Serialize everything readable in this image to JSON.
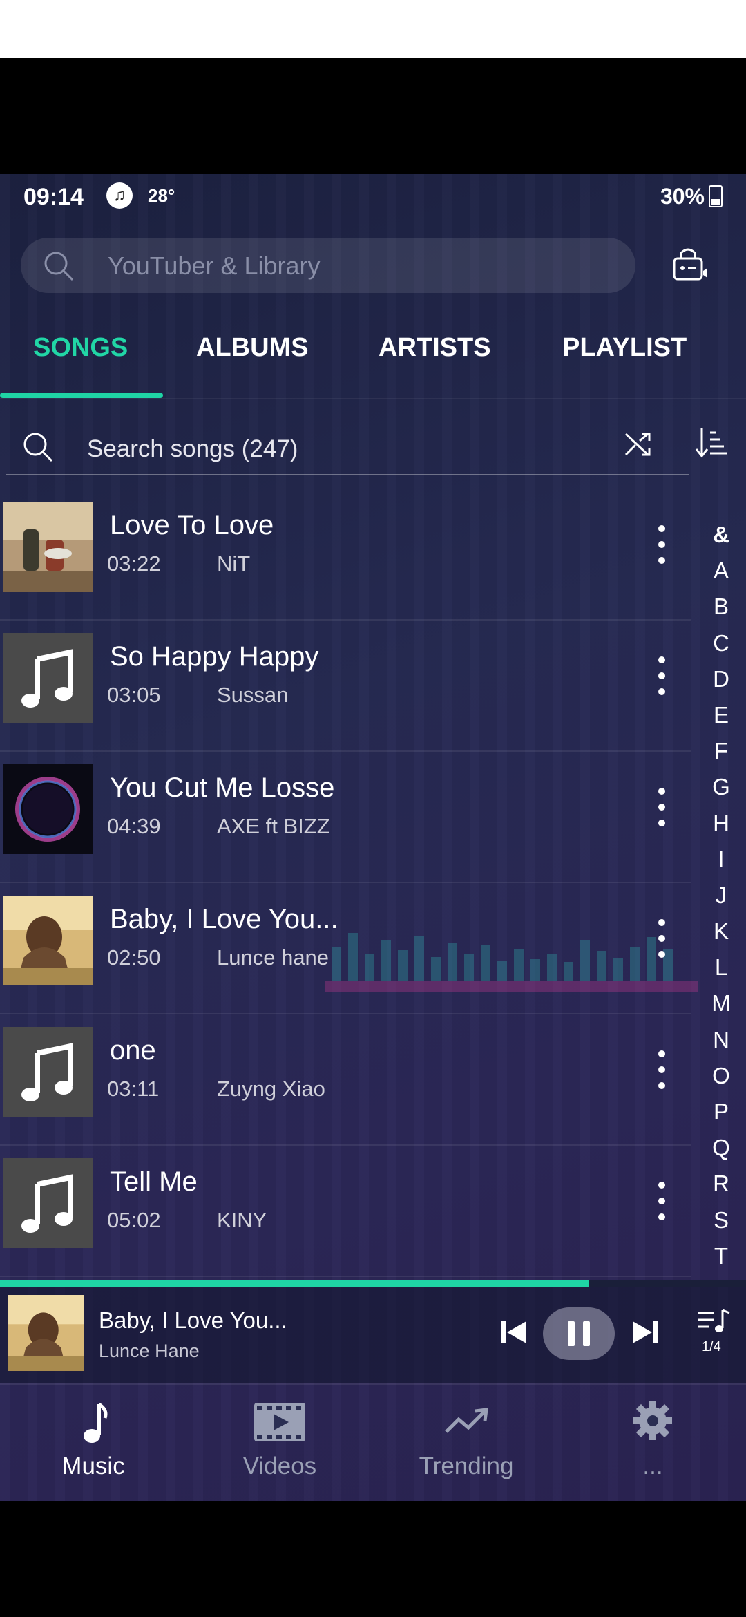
{
  "status_bar": {
    "time": "09:14",
    "temperature": "28°",
    "battery": "30%"
  },
  "search": {
    "placeholder": "YouTuber & Library"
  },
  "tabs": [
    {
      "label": "SONGS",
      "active": true
    },
    {
      "label": "ALBUMS",
      "active": false
    },
    {
      "label": "ARTISTS",
      "active": false
    },
    {
      "label": "PLAYLIST",
      "active": false
    }
  ],
  "song_search": {
    "label": "Search songs (247)"
  },
  "songs": [
    {
      "title": "Love To Love",
      "duration": "03:22",
      "artist": "NiT",
      "art": "photo-table"
    },
    {
      "title": "So Happy Happy",
      "duration": "03:05",
      "artist": "Sussan",
      "art": "music-note"
    },
    {
      "title": "You Cut Me Losse",
      "duration": "04:39",
      "artist": "AXE ft BIZZ",
      "art": "neon-ring"
    },
    {
      "title": "Baby, I Love You...",
      "duration": "02:50",
      "artist": "Lunce hane",
      "art": "photo-girl"
    },
    {
      "title": "one",
      "duration": "03:11",
      "artist": "Zuyng Xiao",
      "art": "music-note"
    },
    {
      "title": "Tell Me",
      "duration": "05:02",
      "artist": "KINY",
      "art": "music-note"
    }
  ],
  "alphabet": [
    "&",
    "A",
    "B",
    "C",
    "D",
    "E",
    "F",
    "G",
    "H",
    "I",
    "J",
    "K",
    "L",
    "M",
    "N",
    "O",
    "P",
    "Q",
    "R",
    "S",
    "T"
  ],
  "now_playing": {
    "title": "Baby, I Love You...",
    "artist": "Lunce Hane",
    "queue": "1/4",
    "progress": 0.79
  },
  "bottom_nav": [
    {
      "label": "Music",
      "icon": "music-note-icon",
      "active": true
    },
    {
      "label": "Videos",
      "icon": "film-icon",
      "active": false
    },
    {
      "label": "Trending",
      "icon": "trending-icon",
      "active": false
    },
    {
      "label": "...",
      "icon": "gear-icon",
      "active": false
    }
  ],
  "colors": {
    "accent": "#1fd4a5",
    "background": "#262a52"
  }
}
